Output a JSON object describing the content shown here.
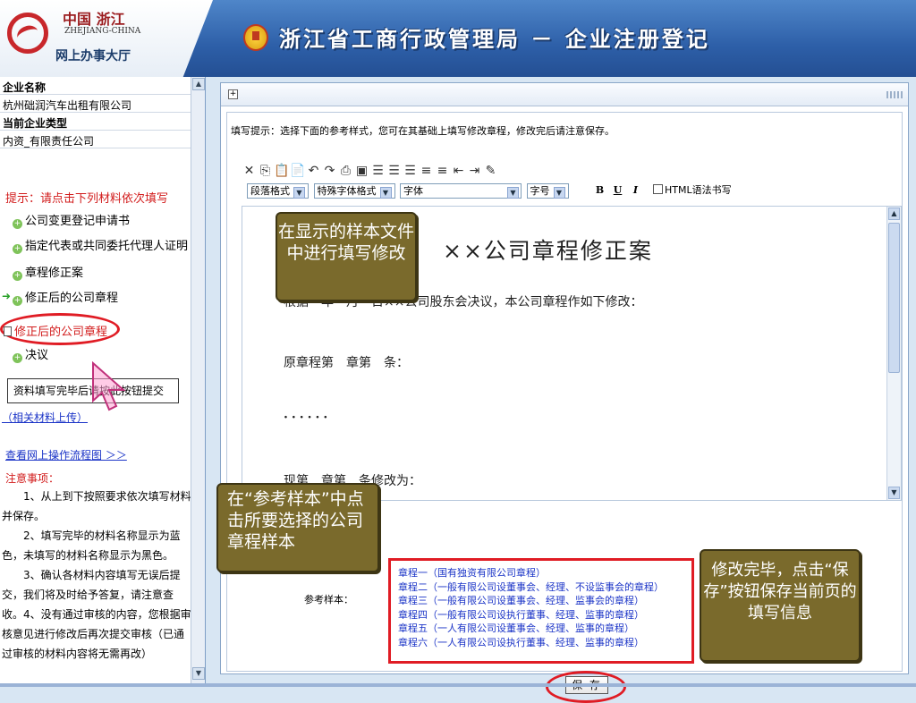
{
  "header": {
    "org_cn": "中国 浙江",
    "org_en": "ZHEJIANG-CHINA",
    "org_sub": "网上办事大厅",
    "main_title": "浙江省工商行政管理局 － 企业注册登记"
  },
  "sidebar": {
    "company_name_label": "企业名称",
    "company_name": "杭州础润汽车出租有限公司",
    "company_type_label": "当前企业类型",
    "company_type": "内资_有限责任公司",
    "hint": "提示：请点击下列材料依次填写",
    "steps": [
      "公司变更登记申请书",
      "指定代表或共同委托代理人证明",
      "章程修正案",
      "修正后的公司章程"
    ],
    "current_step": "修正后的公司章程",
    "next_step": "决议",
    "tooltip": "资料填写完毕后请按此按钮提交",
    "upload_link": "（相关材料上传）",
    "flow_link": "查看网上操作流程图 ＞＞",
    "notes_title": "注意事项：",
    "notes": [
      "　　1、从上到下按照要求依次填写材料并保存。",
      "　　2、填写完毕的材料名称显示为蓝色，未填写的材料名称显示为黑色。",
      "　　3、确认各材料内容填写无误后提交，我们将及时给予答复，请注意查收。",
      "　　4、没有通过审核的内容，您根据审核意见进行修改后再次提交审核（已通过审核的材料内容将无需再改）"
    ]
  },
  "main": {
    "fill_tip": "填写提示：选择下面的参考样式，您可在其基础上填写修改章程，修改完后请注意保存。",
    "toolbar_icons": [
      "cut-icon",
      "copy-icon",
      "paste-icon",
      "paste-word-icon",
      "undo-icon",
      "redo-icon",
      "print-icon",
      "save-icon",
      "align-left-icon",
      "align-center-icon",
      "align-right-icon",
      "ordered-list-icon",
      "unordered-list-icon",
      "outdent-icon",
      "indent-icon",
      "clear-format-icon"
    ],
    "select_paragraph": "段落格式",
    "select_style": "特殊字体格式",
    "select_font": "字体",
    "select_size": "字号",
    "bold": "B",
    "underline": "U",
    "italic": "I",
    "html_mode_label": "HTML语法书写",
    "doc_title": "××公司章程修正案",
    "doc_lines": [
      "根据　年　月　日××公司股东会决议，本公司章程作如下修改：",
      "原章程第　章第　条：",
      "······",
      "现第　章第　条修改为："
    ],
    "ref_label": "参考样本：",
    "ref_samples": [
      "章程一（国有独资有限公司章程）",
      "章程二（一般有限公司设董事会、经理、不设监事会的章程）",
      "章程三（一般有限公司设董事会、经理、监事会的章程）",
      "章程四（一般有限公司设执行董事、经理、监事的章程）",
      "章程五（一人有限公司设董事会、经理、监事的章程）",
      "章程六（一人有限公司设执行董事、经理、监事的章程）"
    ],
    "save_label": "保 存"
  },
  "callouts": {
    "edit_sample": "在显示的样本文件中进行填写修改",
    "choose_sample": "在“参考样本”中点击所要选择的公司章程样本",
    "save_hint": "修改完毕，点击“保存”按钮保存当前页的填写信息"
  },
  "colors": {
    "accent_red": "#e01c24",
    "link_blue": "#1b34c7",
    "header_blue": "#2d5fa8",
    "callout_olive": "#7a6a2c"
  }
}
